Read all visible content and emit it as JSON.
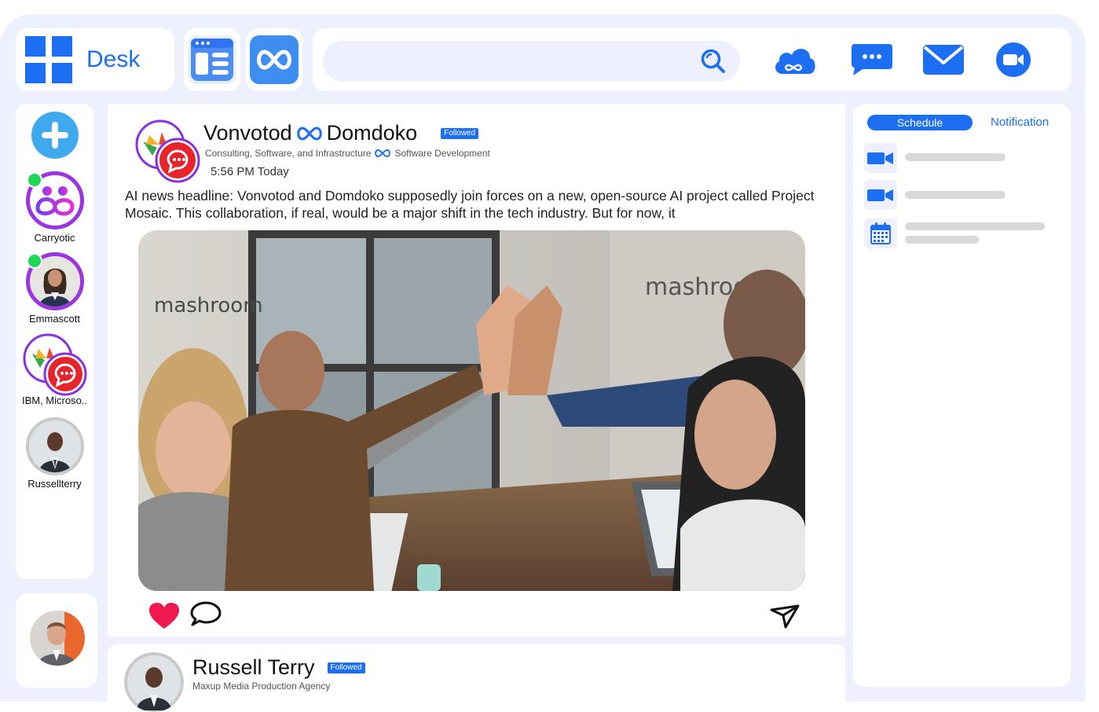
{
  "app": {
    "name": "Desk"
  },
  "search": {
    "placeholder": ""
  },
  "sidebar": {
    "contacts": [
      {
        "name": "Carryotic",
        "online": true
      },
      {
        "name": "Emmascott",
        "online": true
      },
      {
        "name": "IBM, Microso..",
        "online": false
      },
      {
        "name": "Russellterry",
        "online": false
      }
    ]
  },
  "post": {
    "author_left": "Vonvotod",
    "author_right": "Domdoko",
    "badge": "Followed",
    "subtitle_left": "Consulting, Software, and Infrastructure",
    "subtitle_right": "Software Development",
    "time": "5:56 PM Today",
    "body": "AI news headline: Vonvotod and Domdoko supposedly join forces on a new, open-source AI project called Project Mosaic. This collaboration, if real, would be a major shift in the tech industry. But for now, it",
    "image_text": "mashroom"
  },
  "post2": {
    "author": "Russell Terry",
    "badge": "Followed",
    "subtitle": "Maxup Media Production Agency"
  },
  "right_panel": {
    "tab_schedule": "Schedule",
    "tab_notification": "Notification"
  },
  "colors": {
    "accent": "#1c6ef2",
    "bg": "#eef0fd",
    "like": "#f0194f",
    "online": "#1fd655"
  }
}
